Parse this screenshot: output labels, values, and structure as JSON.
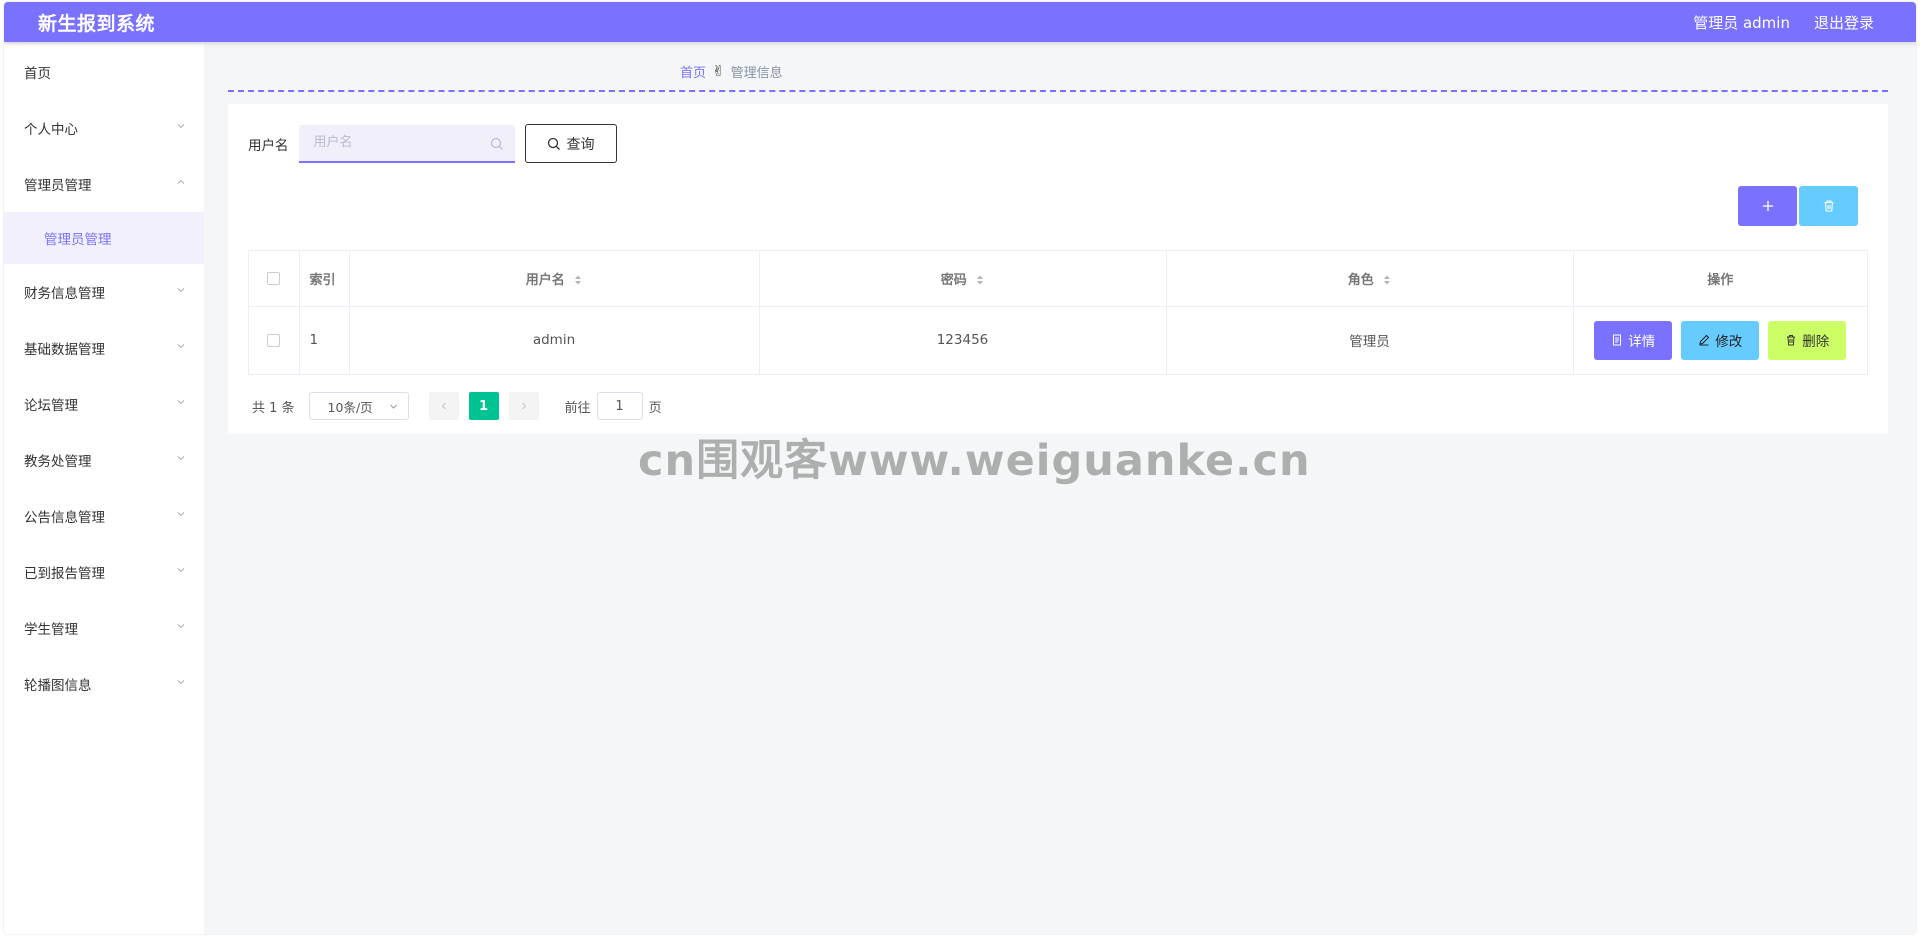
{
  "header": {
    "title": "新生报到系统",
    "user": "管理员 admin",
    "logout": "退出登录"
  },
  "sidebar": {
    "items": [
      {
        "label": "首页"
      },
      {
        "label": "个人中心"
      },
      {
        "label": "管理员管理"
      },
      {
        "label": "财务信息管理"
      },
      {
        "label": "基础数据管理"
      },
      {
        "label": "论坛管理"
      },
      {
        "label": "教务处管理"
      },
      {
        "label": "公告信息管理"
      },
      {
        "label": "已到报告管理"
      },
      {
        "label": "学生管理"
      },
      {
        "label": "轮播图信息"
      }
    ],
    "submenu": {
      "label": "管理员管理"
    }
  },
  "breadcrumb": {
    "home": "首页",
    "current": "管理信息"
  },
  "search": {
    "label": "用户名",
    "placeholder": "用户名",
    "value": "",
    "button": "查询"
  },
  "table": {
    "columns": {
      "index": "索引",
      "username": "用户名",
      "password": "密码",
      "role": "角色",
      "actions": "操作"
    },
    "rows": [
      {
        "index": "1",
        "username": "admin",
        "password": "123456",
        "role": "管理员"
      }
    ],
    "row_buttons": {
      "detail": "详情",
      "edit": "修改",
      "delete": "删除"
    }
  },
  "pagination": {
    "total": "共 1 条",
    "page_size": "10条/页",
    "current_page": "1",
    "goto_label": "前往",
    "goto_value": "1",
    "page_suffix": "页"
  },
  "watermark": "cn围观客www.weiguanke.cn",
  "colors": {
    "primary": "#7a71ff",
    "info": "#66ccff",
    "lime": "#ccff66",
    "page_active": "#00c292"
  }
}
